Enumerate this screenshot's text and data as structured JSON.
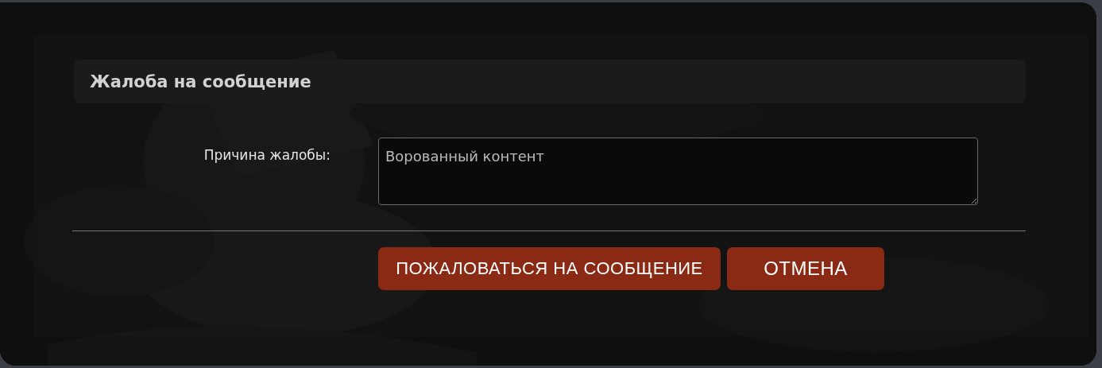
{
  "dialog": {
    "title": "Жалоба на сообщение",
    "reason_label": "Причина жалобы:",
    "reason_value": "Ворованный контент",
    "buttons": [
      {
        "label": "ПОЖАЛОВАТЬСЯ НА СООБЩЕНИЕ"
      },
      {
        "label": "ОТМЕНА"
      }
    ]
  }
}
